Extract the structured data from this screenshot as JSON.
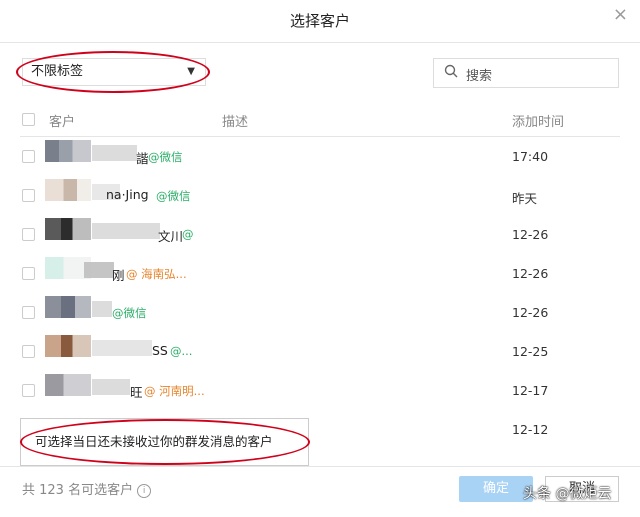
{
  "dialog": {
    "title": "选择客户"
  },
  "filter": {
    "selected": "不限标签"
  },
  "search": {
    "placeholder": "搜索"
  },
  "table": {
    "headers": {
      "name": "客户",
      "description": "描述",
      "added_time": "添加时间"
    },
    "rows": [
      {
        "name": "諧",
        "source": "@微信",
        "source_color": "#2aae67",
        "time": "17:40"
      },
      {
        "name": "na·Jing",
        "source": "@微信",
        "source_color": "#2aae67",
        "time": "昨天"
      },
      {
        "name": "文川",
        "source": "@",
        "source_color": "#2aae67",
        "time": "12-26"
      },
      {
        "name": "刚",
        "source": "@ 海南弘...",
        "source_color": "#e6832a",
        "time": "12-26"
      },
      {
        "name": "",
        "source": "@微信",
        "source_color": "#2aae67",
        "time": "12-26"
      },
      {
        "name": "SS",
        "source": "@...",
        "source_color": "#2aae67",
        "time": "12-25"
      },
      {
        "name": "旺",
        "source": "@ 河南明...",
        "source_color": "#e6832a",
        "time": "12-17"
      },
      {
        "name": "",
        "source": "",
        "source_color": "#2aae67",
        "time": "12-12"
      }
    ]
  },
  "tooltip": {
    "text": "可选择当日还未接收过你的群发消息的客户"
  },
  "footer": {
    "count_text": "共 123 名可选客户",
    "confirm_label": "确定",
    "cancel_label": "取消"
  },
  "watermark": {
    "text": "头条 @微炬云"
  },
  "colors": {
    "highlight": "#d0021b",
    "confirm_bg": "#a9d3f5"
  }
}
